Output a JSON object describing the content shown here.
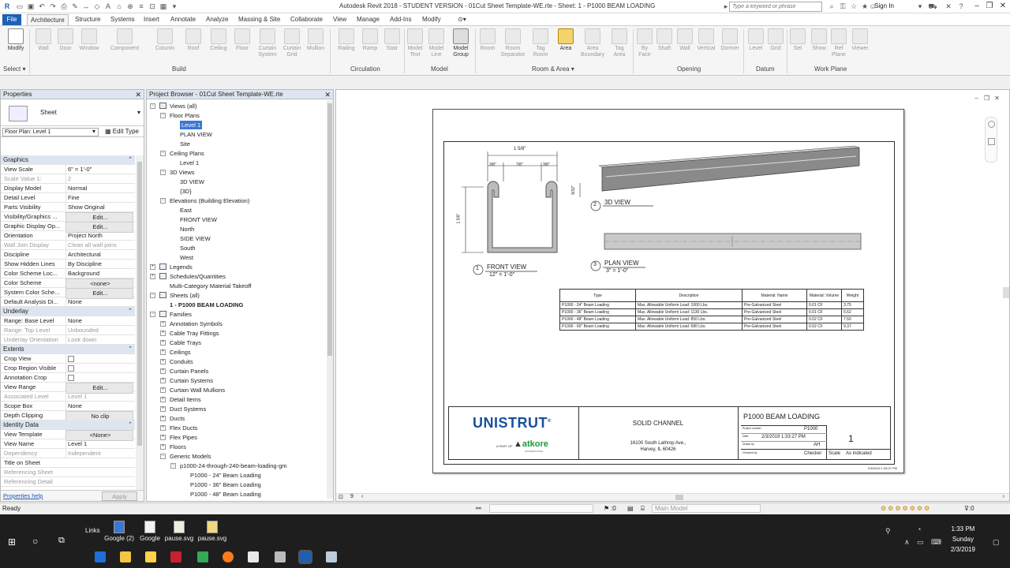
{
  "window": {
    "title": "Autodesk Revit 2018 -  STUDENT VERSION -   01Cut Sheet Template-WE.rte - Sheet: 1 - P1000 BEAM LOADING",
    "search_placeholder": "Type a keyword or phrase",
    "sign_in": "Sign In"
  },
  "tabs": [
    "File",
    "Architecture",
    "Structure",
    "Systems",
    "Insert",
    "Annotate",
    "Analyze",
    "Massing & Site",
    "Collaborate",
    "View",
    "Manage",
    "Add-Ins",
    "Modify"
  ],
  "ribbon": {
    "modify": "Modify",
    "select": "Select",
    "build_tools": [
      "Wall",
      "Door",
      "Window",
      "Component",
      "Column",
      "Roof",
      "Ceiling",
      "Floor",
      "Curtain System",
      "Curtain Grid",
      "Mullion"
    ],
    "circulation_tools": [
      "Railing",
      "Ramp",
      "Stair"
    ],
    "model_tools": [
      "Model Text",
      "Model Line",
      "Model Group"
    ],
    "room_tools": [
      "Room",
      "Room Separator",
      "Tag Room",
      "Area",
      "Area Boundary",
      "Tag Area"
    ],
    "opening_tools": [
      "By Face",
      "Shaft",
      "Wall",
      "Vertical",
      "Dormer"
    ],
    "datum_tools": [
      "Level",
      "Grid"
    ],
    "workplane_tools": [
      "Set",
      "Show",
      "Ref Plane",
      "Viewer"
    ],
    "panels": [
      "Build",
      "Circulation",
      "Model",
      "Room & Area",
      "Opening",
      "Datum",
      "Work Plane"
    ]
  },
  "properties": {
    "title": "Properties",
    "type_name": "Sheet",
    "instance": "Floor Plan: Level 1",
    "edit_type": "Edit Type",
    "groups": {
      "graphics": "Graphics",
      "underlay": "Underlay",
      "extents": "Extents",
      "identity": "Identity Data"
    },
    "graphics": [
      {
        "k": "View Scale",
        "v": "6\" = 1'-0\""
      },
      {
        "k": "Scale Value    1:",
        "v": "2"
      },
      {
        "k": "Display Model",
        "v": "Normal"
      },
      {
        "k": "Detail Level",
        "v": "Fine"
      },
      {
        "k": "Parts Visibility",
        "v": "Show Original"
      },
      {
        "k": "Visibility/Graphics ...",
        "v": "Edit..."
      },
      {
        "k": "Graphic Display Op...",
        "v": "Edit..."
      },
      {
        "k": "Orientation",
        "v": "Project North"
      },
      {
        "k": "Wall Join Display",
        "v": "Clean all wall joins"
      },
      {
        "k": "Discipline",
        "v": "Architectural"
      },
      {
        "k": "Show Hidden Lines",
        "v": "By Discipline"
      },
      {
        "k": "Color Scheme Loc...",
        "v": "Background"
      },
      {
        "k": "Color Scheme",
        "v": "<none>"
      },
      {
        "k": "System Color Sche...",
        "v": "Edit..."
      },
      {
        "k": "Default Analysis Di...",
        "v": "None"
      }
    ],
    "underlay": [
      {
        "k": "Range: Base Level",
        "v": "None"
      },
      {
        "k": "Range: Top Level",
        "v": "Unbounded"
      },
      {
        "k": "Underlay Orientation",
        "v": "Look down"
      }
    ],
    "extents": [
      {
        "k": "Crop View",
        "v": ""
      },
      {
        "k": "Crop Region Visible",
        "v": ""
      },
      {
        "k": "Annotation Crop",
        "v": ""
      },
      {
        "k": "View Range",
        "v": "Edit..."
      },
      {
        "k": "Associated Level",
        "v": "Level 1"
      },
      {
        "k": "Scope Box",
        "v": "None"
      },
      {
        "k": "Depth Clipping",
        "v": "No clip"
      }
    ],
    "identity": [
      {
        "k": "View Template",
        "v": "<None>"
      },
      {
        "k": "View Name",
        "v": "Level 1"
      },
      {
        "k": "Dependency",
        "v": "Independent"
      },
      {
        "k": "Title on Sheet",
        "v": ""
      },
      {
        "k": "Referencing Sheet",
        "v": ""
      },
      {
        "k": "Referencing Detail",
        "v": ""
      }
    ],
    "help": "Properties help",
    "apply": "Apply"
  },
  "browser": {
    "title": "Project Browser - 01Cut Sheet Template-WE.rte",
    "nodes": [
      "Views (all)",
      "Floor Plans",
      "Level 1",
      "PLAN VIEW",
      "Site",
      "Ceiling Plans",
      "Level 1",
      "3D Views",
      "3D VIEW",
      "{3D}",
      "Elevations (Building Elevation)",
      "East",
      "FRONT VIEW",
      "North",
      "SIDE VIEW",
      "South",
      "West",
      "Legends",
      "Schedules/Quantities",
      "Multi-Category Material Takeoff",
      "Sheets (all)",
      "1 - P1000 BEAM LOADING",
      "Families",
      "Annotation Symbols",
      "Cable Tray Fittings",
      "Cable Trays",
      "Ceilings",
      "Conduits",
      "Curtain Panels",
      "Curtain Systems",
      "Curtain Wall Mullions",
      "Detail Items",
      "Duct Systems",
      "Ducts",
      "Flex Ducts",
      "Flex Pipes",
      "Floors",
      "Generic Models",
      "p1000-24-through-240-beam-loading-gm",
      "P1000 - 24\" Beam Loading",
      "P1000 - 36\" Beam Loading",
      "P1000 - 48\" Beam Loading"
    ]
  },
  "sheet": {
    "dims": {
      "overall": "1 5/8\"",
      "left": "3/8\"",
      "mid": "7/8\"",
      "right": "3/8\"",
      "height": "1 5/8\"",
      "lip": "9/32\""
    },
    "views": [
      {
        "num": "1",
        "name": "FRONT VIEW",
        "scale": "12\" = 1'-0\""
      },
      {
        "num": "2",
        "name": "3D VIEW",
        "scale": ""
      },
      {
        "num": "3",
        "name": "PLAN VIEW",
        "scale": "3\" = 1'-0\""
      }
    ],
    "schedule": {
      "headers": [
        "Type",
        "Description",
        "Material: Name",
        "Material: Volume",
        "Weight"
      ],
      "rows": [
        [
          "P1000 - 24\" Beam Loading",
          "Max. Allowable Uniform Load: 1600 Lbs.",
          "Pre-Galvanized Steel",
          "0.01 CF",
          "3.75"
        ],
        [
          "P1000 - 36\" Beam Loading",
          "Max. Allowable Uniform Load: 1130 Lbs.",
          "Pre-Galvanized Steel",
          "0.01 CF",
          "5.62"
        ],
        [
          "P1000 - 48\" Beam Loading",
          "Max. Allowable Uniform Load: 850 Lbs.",
          "Pre-Galvanized Steel",
          "0.02 CF",
          "7.50"
        ],
        [
          "P1000 - 60\" Beam Loading",
          "Max. Allowable Uniform Load: 680 Lbs.",
          "Pre-Galvanized Steel",
          "0.02 CF",
          "9.37"
        ]
      ]
    },
    "titleblock": {
      "brand": "UNISTRUT",
      "brand_mark": "®",
      "partof": "A PART OF",
      "parent": "atkore",
      "parent_sub": "INTERNATIONAL",
      "product": "SOLID CHANNEL",
      "address1": "16100 South Lathrop Ave.,",
      "address2": "Harvey, IL 60426",
      "sheet_title": "P1000 BEAM LOADING",
      "project_number_lbl": "Project number",
      "project_number": "P1000",
      "date_lbl": "Date",
      "date": "2/3/2019 1:33:27 PM",
      "drawn_lbl": "Drawn by",
      "drawn": "AH",
      "checked_lbl": "Checked by",
      "checked": "Checker",
      "sheet_no": "1",
      "scale_lbl": "Scale",
      "scale": "As indicated"
    },
    "stamp": "2/3/2019 1:33:27 PM"
  },
  "viewbar": {
    "page": "9"
  },
  "status": {
    "ready": "Ready",
    "zero": ":0",
    "model": "Main Model"
  },
  "taskbar": {
    "links": "Links",
    "items": [
      "Google (2)",
      "Google",
      "pause.svg",
      "pause.svg"
    ],
    "time": "1:33 PM",
    "day": "Sunday",
    "date": "2/3/2019"
  },
  "colors": {
    "file_tab": "#1e5fb4",
    "unistrut": "#1a4f9c",
    "atkore": "#1a9a3a",
    "selection": "#3a78d4"
  }
}
